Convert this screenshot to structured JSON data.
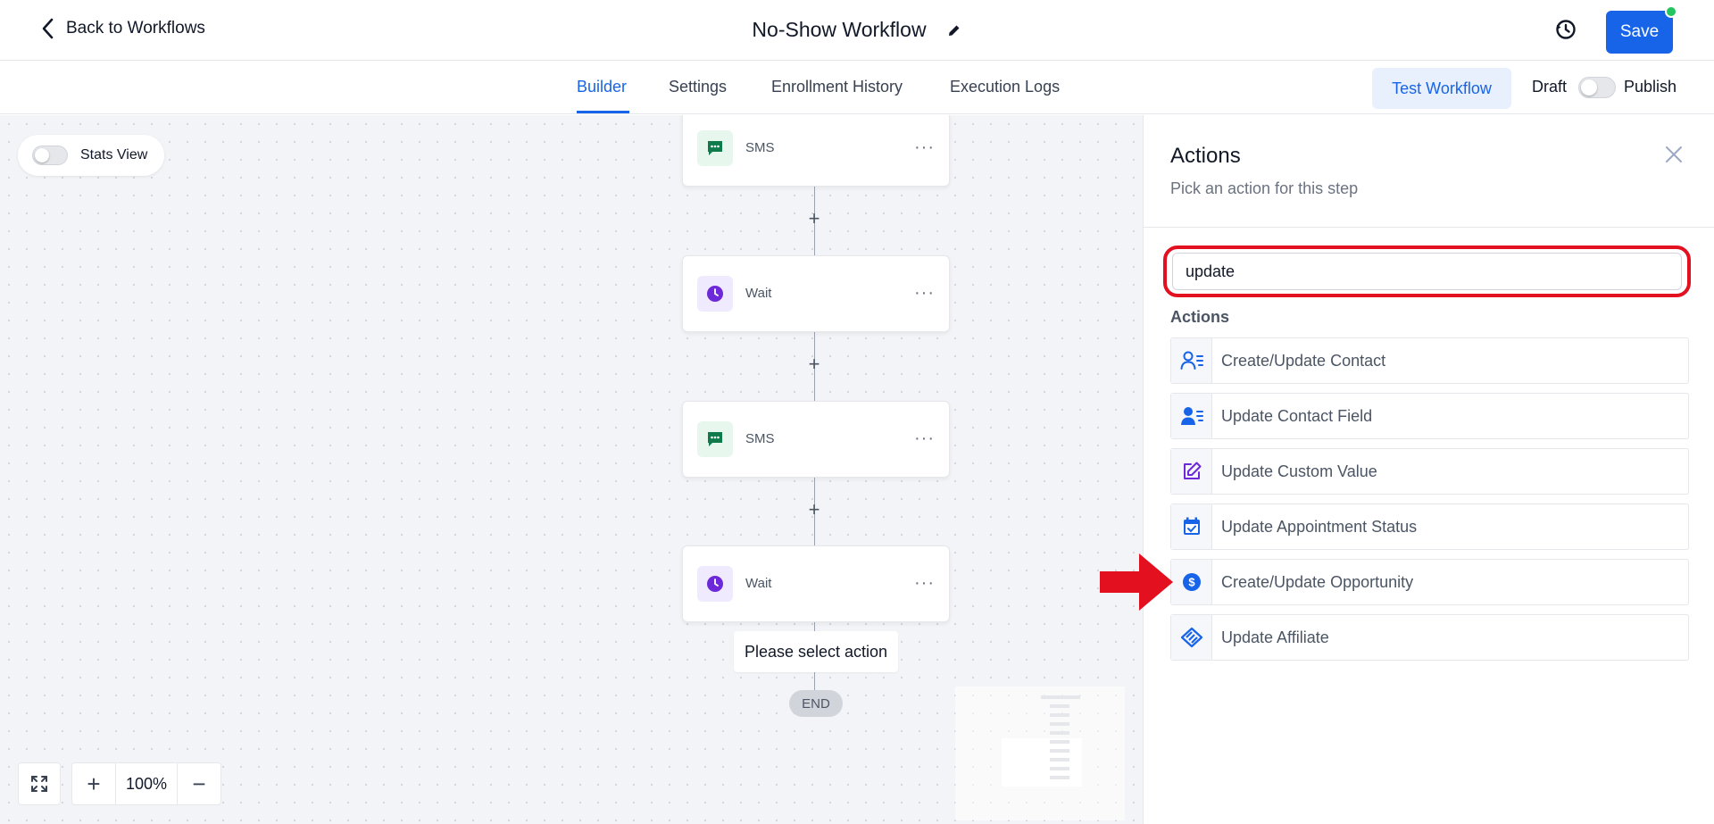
{
  "header": {
    "back_label": "Back to Workflows",
    "title": "No-Show Workflow",
    "save_label": "Save"
  },
  "tabs": {
    "items": [
      {
        "label": "Builder",
        "active": true
      },
      {
        "label": "Settings",
        "active": false
      },
      {
        "label": "Enrollment History",
        "active": false
      },
      {
        "label": "Execution Logs",
        "active": false
      }
    ],
    "test_label": "Test Workflow",
    "draft_label": "Draft",
    "publish_label": "Publish"
  },
  "canvas": {
    "stats_label": "Stats View",
    "nodes": [
      {
        "type": "sms",
        "label": "SMS"
      },
      {
        "type": "wait",
        "label": "Wait"
      },
      {
        "type": "sms",
        "label": "SMS"
      },
      {
        "type": "wait",
        "label": "Wait"
      }
    ],
    "plus": "+",
    "node_menu": "···",
    "select_action_label": "Please select action",
    "end_label": "END",
    "zoom": "100%",
    "zoom_in": "+",
    "zoom_out": "−"
  },
  "panel": {
    "title": "Actions",
    "subtitle": "Pick an action for this step",
    "search_value": "update",
    "section_label": "Actions",
    "actions": [
      {
        "label": "Create/Update Contact",
        "icon": "contact-list-icon"
      },
      {
        "label": "Update Contact Field",
        "icon": "contact-field-icon"
      },
      {
        "label": "Update Custom Value",
        "icon": "edit-icon"
      },
      {
        "label": "Update Appointment Status",
        "icon": "calendar-check-icon"
      },
      {
        "label": "Create/Update Opportunity",
        "icon": "dollar-icon"
      },
      {
        "label": "Update Affiliate",
        "icon": "affiliate-icon"
      }
    ]
  },
  "colors": {
    "primary": "#1764e8",
    "highlight": "#e3101f",
    "sms": "#0f7b4b",
    "wait": "#6d28d9"
  }
}
